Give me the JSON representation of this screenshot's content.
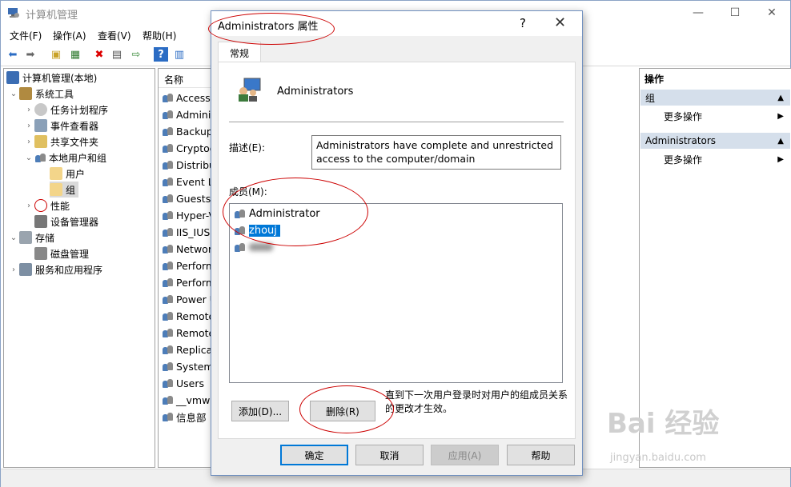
{
  "app": {
    "title": "计算机管理",
    "controls": {
      "minimize": "—",
      "maximize": "☐",
      "close": "✕"
    }
  },
  "menu": [
    "文件(F)",
    "操作(A)",
    "查看(V)",
    "帮助(H)"
  ],
  "tree": [
    {
      "label": "计算机管理(本地)"
    },
    {
      "label": "系统工具"
    },
    {
      "label": "任务计划程序"
    },
    {
      "label": "事件查看器"
    },
    {
      "label": "共享文件夹"
    },
    {
      "label": "本地用户和组"
    },
    {
      "label": "用户"
    },
    {
      "label": "组"
    },
    {
      "label": "性能"
    },
    {
      "label": "设备管理器"
    },
    {
      "label": "存储"
    },
    {
      "label": "磁盘管理"
    },
    {
      "label": "服务和应用程序"
    }
  ],
  "list": {
    "header": "名称",
    "items": [
      "Access",
      "Adminis",
      "Backup",
      "Cryptog",
      "Distribu",
      "Event Lo",
      "Guests",
      "Hyper-V",
      "IIS_IUSR",
      "Networ",
      "Perform",
      "Perform",
      "Power U",
      "Remote",
      "Remote",
      "Replicat",
      "System",
      "Users",
      "__vmwa",
      "信息部"
    ]
  },
  "actions": {
    "title": "操作",
    "sections": [
      {
        "header": "组",
        "item": "更多操作"
      },
      {
        "header": "Administrators",
        "item": "更多操作"
      }
    ]
  },
  "dialog": {
    "title": "Administrators 属性",
    "help": "?",
    "close": "✕",
    "tab": "常规",
    "group_name": "Administrators",
    "description_label": "描述(E):",
    "description": "Administrators have complete and unrestricted access to the computer/domain",
    "members_label": "成员(M):",
    "members": [
      "Administrator",
      "zhouj"
    ],
    "add_button": "添加(D)...",
    "remove_button": "删除(R)",
    "note": "直到下一次用户登录时对用户的组成员关系的更改才生效。",
    "ok_button": "确定",
    "cancel_button": "取消",
    "apply_button": "应用(A)",
    "help_button": "帮助"
  },
  "watermark": {
    "brand": "Bai 经验",
    "url": "jingyan.baidu.com"
  },
  "colors": {
    "selection": "#0078d7",
    "annotation": "#cc0000",
    "action_header": "#d5dfeb"
  }
}
